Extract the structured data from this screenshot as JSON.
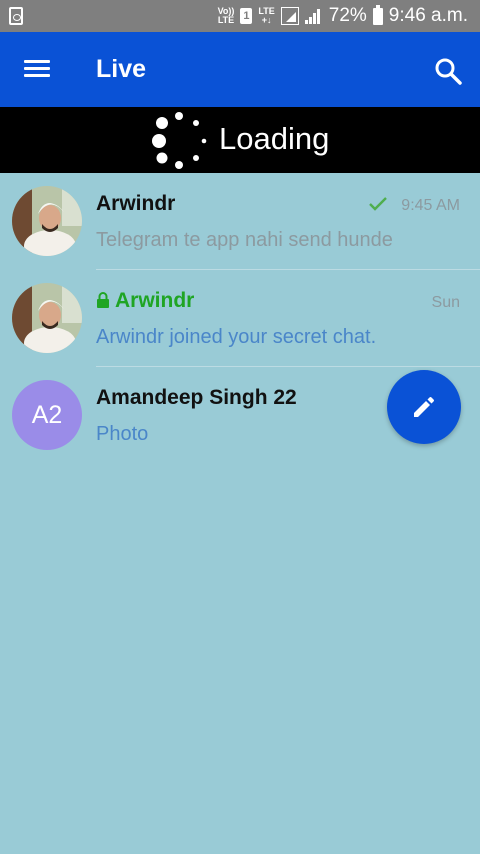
{
  "status_bar": {
    "carrier_top": "Vo))",
    "carrier_bottom": "LTE",
    "sim_slot": "1",
    "network_top": "LTE",
    "network_bottom": "+↓",
    "battery": "72%",
    "time": "9:46 a.m."
  },
  "app_bar": {
    "title": "Live",
    "menu_icon": "hamburger-menu-icon",
    "search_icon": "search-icon",
    "color": "#0a52d6"
  },
  "loading": {
    "text": "Loading"
  },
  "chats": [
    {
      "name": "Arwindr",
      "message": "Telegram te app nahi send hunde",
      "time": "9:45 AM",
      "read_check": true,
      "avatar": "photo"
    },
    {
      "name": "Arwindr",
      "message": "Arwindr joined your secret chat.",
      "time": "Sun",
      "secret": true,
      "avatar": "photo"
    },
    {
      "name": "Amandeep Singh 22",
      "message": "Photo",
      "time": "",
      "avatar_initials": "A2",
      "avatar_color": "#9a8ce8"
    }
  ],
  "fab": {
    "icon": "pencil-icon"
  },
  "colors": {
    "background": "#99cbd6",
    "accent": "#0a52d6",
    "secret_name": "#1fa524",
    "message_blue": "#4a86c9",
    "message_gray": "#8c9aa0"
  }
}
